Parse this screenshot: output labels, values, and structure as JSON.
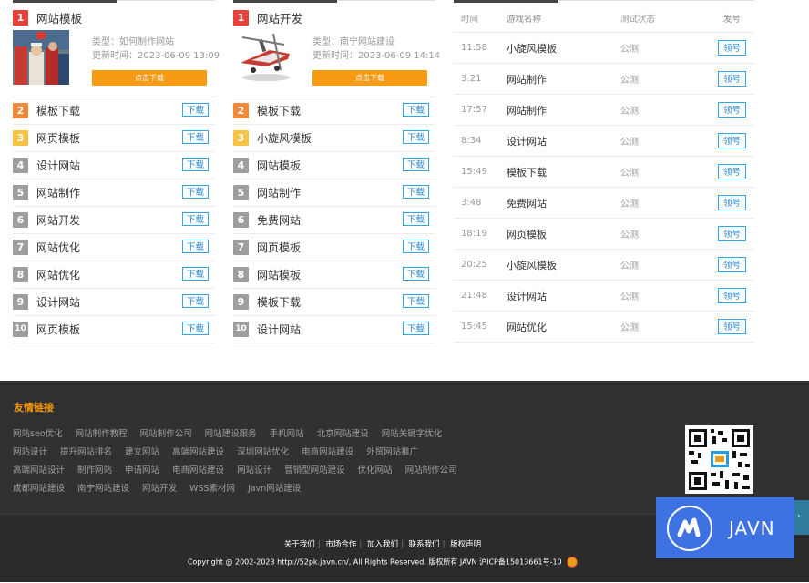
{
  "left_panel": {
    "featured": {
      "rank": "1",
      "title": "网站模板",
      "type_text": "类型：如何制作网站",
      "time_text": "更新时间：2023-06-09 13:09",
      "button": "点击下载"
    },
    "items": [
      {
        "rank": "2",
        "label": "模板下载",
        "btn": "下载"
      },
      {
        "rank": "3",
        "label": "网页模板",
        "btn": "下载"
      },
      {
        "rank": "4",
        "label": "设计网站",
        "btn": "下载"
      },
      {
        "rank": "5",
        "label": "网站制作",
        "btn": "下载"
      },
      {
        "rank": "6",
        "label": "网站开发",
        "btn": "下载"
      },
      {
        "rank": "7",
        "label": "网站优化",
        "btn": "下载"
      },
      {
        "rank": "8",
        "label": "网站优化",
        "btn": "下载"
      },
      {
        "rank": "9",
        "label": "设计网站",
        "btn": "下载"
      },
      {
        "rank": "10",
        "label": "网页模板",
        "btn": "下载"
      }
    ]
  },
  "mid_panel": {
    "featured": {
      "rank": "1",
      "title": "网站开发",
      "type_text": "类型：南宁网站建设",
      "time_text": "更新时间：2023-06-09 14:14",
      "button": "点击下载"
    },
    "items": [
      {
        "rank": "2",
        "label": "模板下载",
        "btn": "下载"
      },
      {
        "rank": "3",
        "label": "小旋风模板",
        "btn": "下载"
      },
      {
        "rank": "4",
        "label": "网站模板",
        "btn": "下载"
      },
      {
        "rank": "5",
        "label": "网站制作",
        "btn": "下载"
      },
      {
        "rank": "6",
        "label": "免费网站",
        "btn": "下载"
      },
      {
        "rank": "7",
        "label": "网页模板",
        "btn": "下载"
      },
      {
        "rank": "8",
        "label": "网站模板",
        "btn": "下载"
      },
      {
        "rank": "9",
        "label": "模板下载",
        "btn": "下载"
      },
      {
        "rank": "10",
        "label": "设计网站",
        "btn": "下载"
      }
    ]
  },
  "test_table": {
    "headers": {
      "time": "时间",
      "name": "游戏名称",
      "status": "测试状态",
      "action": "发号"
    },
    "rows": [
      {
        "time": "11:58",
        "name": "小旋风模板",
        "status": "公测",
        "btn": "领号"
      },
      {
        "time": "3:21",
        "name": "网站制作",
        "status": "公测",
        "btn": "领号"
      },
      {
        "time": "17:57",
        "name": "网站制作",
        "status": "公测",
        "btn": "领号"
      },
      {
        "time": "8:34",
        "name": "设计网站",
        "status": "公测",
        "btn": "领号"
      },
      {
        "time": "15:49",
        "name": "模板下载",
        "status": "公测",
        "btn": "领号"
      },
      {
        "time": "3:48",
        "name": "免费网站",
        "status": "公测",
        "btn": "领号"
      },
      {
        "time": "18:19",
        "name": "网页模板",
        "status": "公测",
        "btn": "领号"
      },
      {
        "time": "20:25",
        "name": "小旋风模板",
        "status": "公测",
        "btn": "领号"
      },
      {
        "time": "21:48",
        "name": "设计网站",
        "status": "公测",
        "btn": "领号"
      },
      {
        "time": "15:45",
        "name": "网站优化",
        "status": "公测",
        "btn": "领号"
      }
    ]
  },
  "footer": {
    "links_title": "友情链接",
    "link_rows": [
      [
        "网站seo优化",
        "网站制作教程",
        "网站制作公司",
        "网站建设服务",
        "手机网站",
        "北京网站建设",
        "网站关键字优化"
      ],
      [
        "网站设计",
        "提升网站排名",
        "建立网站",
        "高端网站建设",
        "深圳网站优化",
        "电商网站建设",
        "外贸网站推广"
      ],
      [
        "高端网站设计",
        "制作网站",
        "申请网站",
        "电商网站建设",
        "网站设计",
        "营销型网站建设",
        "优化网站",
        "网站制作公司"
      ],
      [
        "成都网站建设",
        "南宁网站建设",
        "网站开发",
        "WSS素材网",
        "Javn网站建设"
      ]
    ],
    "bottom_nav": [
      "关于我们",
      "市场合作",
      "加入我们",
      "联系我们",
      "版权声明"
    ],
    "copyright": "Copyright @ 2002-2023 http://52pk.javn.cn/, All Rights Reserved. 版权所有 JAVN 沪ICP备15013661号-10"
  },
  "badge": {
    "text": "JAVN"
  },
  "colors": {
    "accent_orange": "#f79a14",
    "link_blue": "#2589d9",
    "footer_bg": "#313131",
    "badge_blue": "#3e72e2"
  }
}
